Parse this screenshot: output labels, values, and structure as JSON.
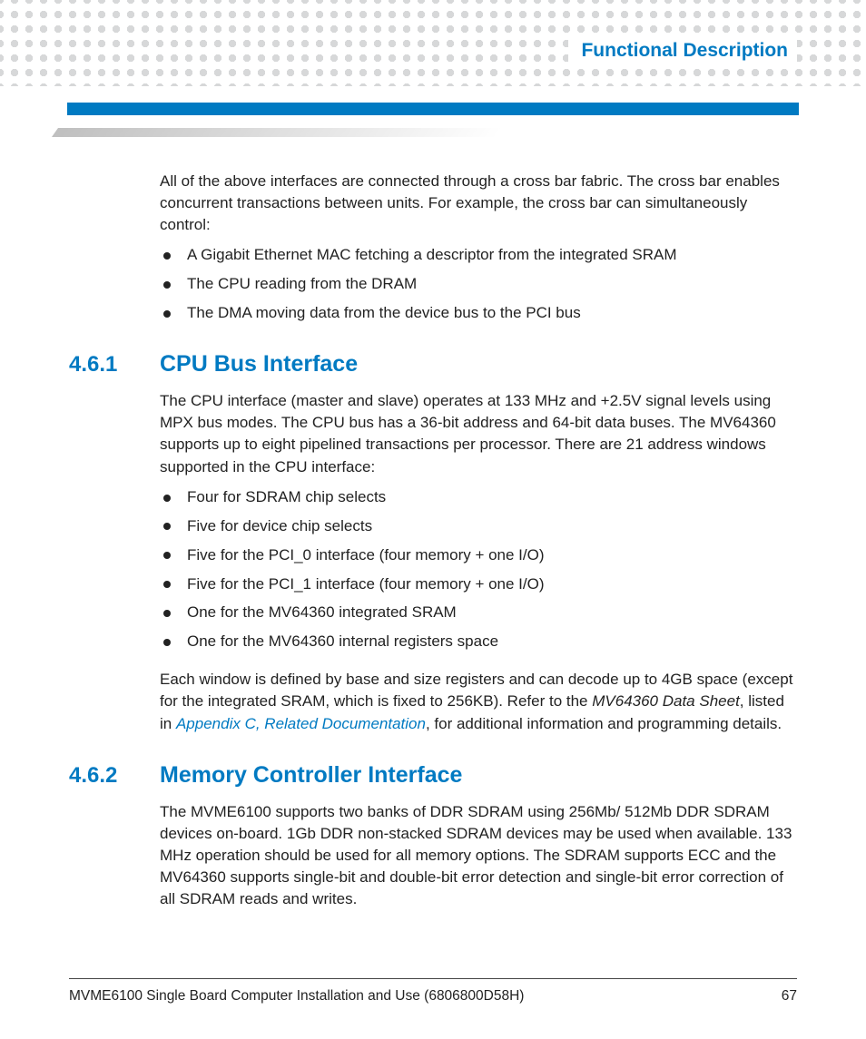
{
  "header": {
    "chapter_title": "Functional Description"
  },
  "intro": {
    "para": "All of the above interfaces are connected through a cross bar fabric. The cross bar enables concurrent transactions between units. For example, the cross bar can simultaneously control:",
    "bullets": [
      "A Gigabit Ethernet MAC fetching a descriptor from the integrated SRAM",
      "The CPU reading from the DRAM",
      "The DMA moving data from the device bus to the PCI bus"
    ]
  },
  "section1": {
    "number": "4.6.1",
    "title": "CPU Bus Interface",
    "para1": "The CPU interface (master and slave) operates at 133 MHz and +2.5V signal levels using MPX bus modes. The CPU bus has a 36-bit address and 64-bit data buses. The MV64360 supports up to eight pipelined transactions per processor. There are 21 address windows supported in the CPU interface:",
    "bullets": [
      "Four for SDRAM chip selects",
      "Five for device chip selects",
      "Five for the PCI_0 interface (four memory + one I/O)",
      "Five for the PCI_1 interface (four memory + one I/O)",
      "One for the MV64360 integrated SRAM",
      "One for the MV64360 internal registers space"
    ],
    "para2_a": "Each window is defined by base and size registers and can decode up to 4GB space (except for the integrated SRAM, which is fixed to 256KB). Refer to the ",
    "para2_ref_italic": "MV64360 Data Sheet",
    "para2_b": ", listed in ",
    "para2_link": "Appendix C, Related Documentation",
    "para2_c": ", for additional information and programming details."
  },
  "section2": {
    "number": "4.6.2",
    "title": "Memory Controller Interface",
    "para": "The MVME6100 supports two banks of DDR SDRAM using 256Mb/ 512Mb DDR SDRAM devices on-board. 1Gb DDR non-stacked SDRAM devices may be used when available. 133 MHz operation should be used for all memory options. The SDRAM supports ECC and the MV64360 supports single-bit and double-bit error detection and single-bit error correction of all SDRAM reads and writes."
  },
  "footer": {
    "doc_title": "MVME6100 Single Board Computer Installation and Use (6806800D58H)",
    "page": "67"
  }
}
